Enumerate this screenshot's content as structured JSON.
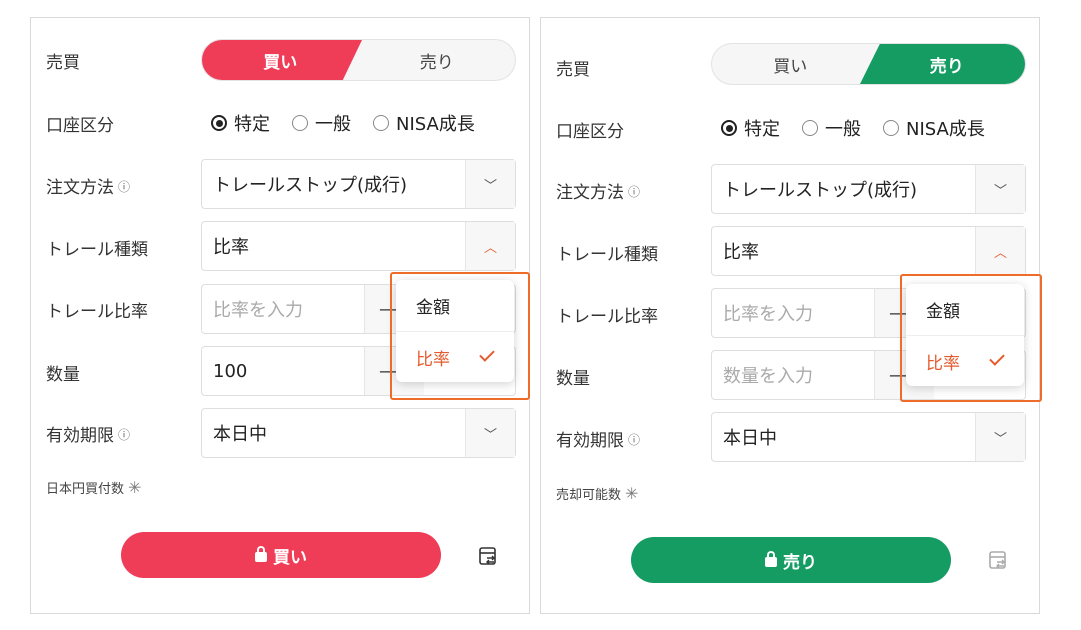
{
  "buy_panel": {
    "side_label": "売買",
    "toggle": {
      "buy": "買い",
      "sell": "売り",
      "active": "buy"
    },
    "account_label": "口座区分",
    "account_options": [
      "特定",
      "一般",
      "NISA成長"
    ],
    "order_method_label": "注文方法",
    "order_method_value": "トレールストップ(成行)",
    "trail_type_label": "トレール種類",
    "trail_type_value": "比率",
    "trail_rate_label": "トレール比率",
    "trail_rate_placeholder": "比率を入力",
    "trail_rate_stepper": "—",
    "quantity_label": "数量",
    "quantity_value": "100",
    "quantity_stepper": "—",
    "expiry_label": "有効期限",
    "expiry_value": "本日中",
    "bottom_label": "日本円買付数",
    "asterisk": "✳",
    "submit_label": "買い",
    "dropdown": [
      {
        "label": "金額",
        "selected": false
      },
      {
        "label": "比率",
        "selected": true
      }
    ]
  },
  "sell_panel": {
    "side_label": "売買",
    "toggle": {
      "buy": "買い",
      "sell": "売り",
      "active": "sell"
    },
    "account_label": "口座区分",
    "account_options": [
      "特定",
      "一般",
      "NISA成長"
    ],
    "order_method_label": "注文方法",
    "order_method_value": "トレールストップ(成行)",
    "trail_type_label": "トレール種類",
    "trail_type_value": "比率",
    "trail_rate_label": "トレール比率",
    "trail_rate_placeholder": "比率を入力",
    "trail_rate_stepper": "—",
    "quantity_label": "数量",
    "quantity_placeholder": "数量を入力",
    "quantity_stepper": "—",
    "expiry_label": "有効期限",
    "expiry_value": "本日中",
    "bottom_label": "売却可能数",
    "asterisk": "✳",
    "submit_label": "売り",
    "dropdown": [
      {
        "label": "金額",
        "selected": false
      },
      {
        "label": "比率",
        "selected": true
      }
    ]
  },
  "icons": {
    "info": "ⓘ",
    "caret_down": "﹀",
    "caret_up": "︿"
  },
  "colors": {
    "buy": "#ef3c57",
    "sell": "#149c63",
    "accent": "#e55b2e"
  }
}
